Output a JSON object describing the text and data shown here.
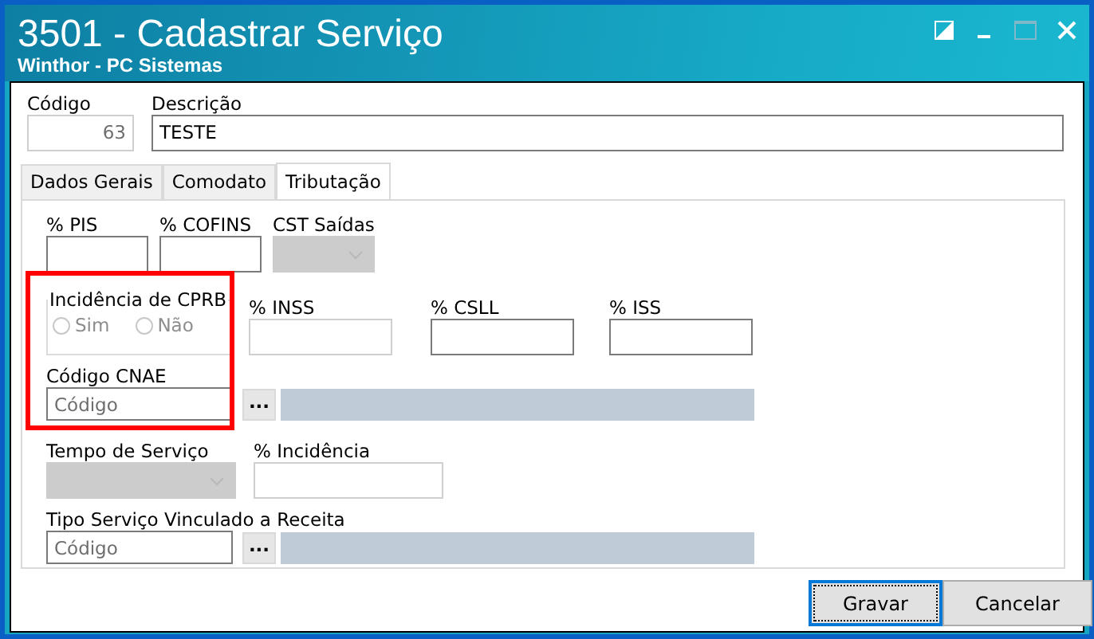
{
  "window": {
    "title": "3501 - Cadastrar Serviço",
    "subtitle": "Winthor - PC Sistemas"
  },
  "header_fields": [
    {
      "label": "Código",
      "value": "63",
      "disabled": true
    },
    {
      "label": "Descrição",
      "value": "TESTE",
      "disabled": false
    }
  ],
  "tabs": [
    {
      "label": "Dados Gerais",
      "selected": false
    },
    {
      "label": "Comodato",
      "selected": false
    },
    {
      "label": "Tributação",
      "selected": true
    }
  ],
  "tax_rows": [
    [
      {
        "kind": "text",
        "label": "% PIS",
        "disabled": false
      },
      {
        "kind": "text",
        "label": "% COFINS",
        "disabled": false
      },
      {
        "kind": "select",
        "label": "CST Saídas",
        "disabled": true
      }
    ],
    [
      {
        "kind": "radio_group",
        "label": "Incidência de CPRB",
        "disabled": true,
        "options": [
          {
            "label": "Sim",
            "selected": false
          },
          {
            "label": "Não",
            "selected": false
          }
        ]
      },
      {
        "kind": "text",
        "label": "% INSS",
        "disabled": true
      },
      {
        "kind": "text",
        "label": "% CSLL",
        "disabled": false
      },
      {
        "kind": "text",
        "label": "% ISS",
        "disabled": false
      }
    ],
    [
      {
        "kind": "lookup",
        "label": "Código CNAE",
        "placeholder": "Código",
        "button": "..."
      }
    ],
    [
      {
        "kind": "select",
        "label": "Tempo de Serviço",
        "disabled": true
      },
      {
        "kind": "text",
        "label": "% Incidência",
        "disabled": true
      }
    ],
    [
      {
        "kind": "lookup",
        "label": "Tipo Serviço Vinculado a Receita",
        "placeholder": "Código",
        "button": "..."
      }
    ]
  ],
  "highlight": {
    "kind": "frame",
    "color": "#ff0000"
  },
  "buttons": [
    {
      "label": "Gravar",
      "focused": true
    },
    {
      "label": "Cancelar",
      "focused": false
    }
  ]
}
